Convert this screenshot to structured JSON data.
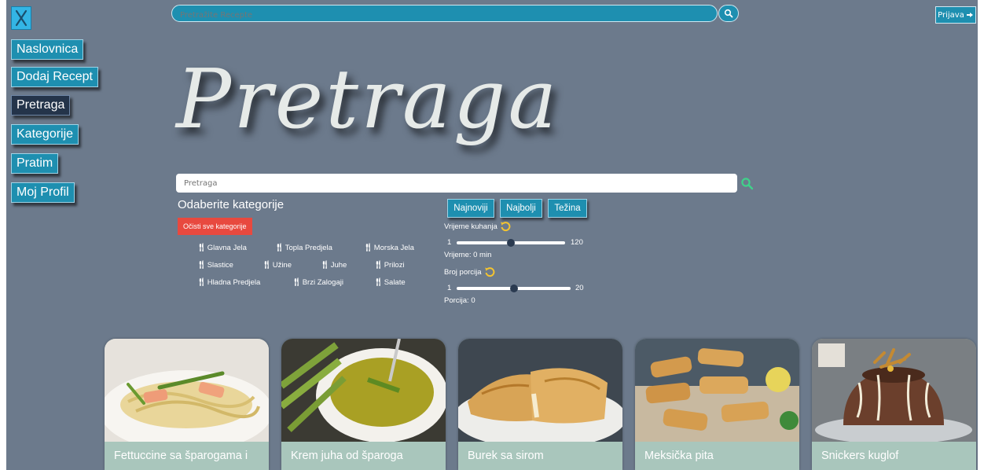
{
  "top_bar": {
    "search_placeholder": "Pretražite Recepte",
    "login_label": "Prijava"
  },
  "nav": {
    "items": [
      {
        "label": "Naslovnica"
      },
      {
        "label": "Dodaj Recept"
      },
      {
        "label": "Pretraga",
        "active": true
      },
      {
        "label": "Kategorije"
      },
      {
        "label": "Pratim"
      },
      {
        "label": "Moj Profil"
      }
    ]
  },
  "page": {
    "title": "Pretraga",
    "search_placeholder": "Pretraga"
  },
  "categories": {
    "heading": "Odaberite kategorije",
    "clear_label": "Očisti sve kategorije",
    "items": [
      "Glavna Jela",
      "Topla Predjela",
      "Morska Jela",
      "Slastice",
      "Užine",
      "Juhe",
      "Prilozi",
      "Hladna Predjela",
      "Brzi Zalogaji",
      "Salate"
    ]
  },
  "sort": {
    "buttons": [
      "Najnoviji",
      "Najbolji",
      "Težina"
    ]
  },
  "filters": {
    "time": {
      "label": "Vrijeme kuhanja",
      "min": "1",
      "max": "120",
      "value_fraction": 0.5,
      "readout": "Vrijeme: 0 min"
    },
    "portions": {
      "label": "Broj porcija",
      "min": "1",
      "max": "20",
      "value_fraction": 0.5,
      "readout": "Porcija: 0"
    }
  },
  "recipes": [
    {
      "title": "Fettuccine sa šparogama i",
      "image": "pasta-salmon-asparagus"
    },
    {
      "title": "Krem juha od šparoga",
      "image": "asparagus-soup"
    },
    {
      "title": "Burek sa sirom",
      "image": "cheese-burek"
    },
    {
      "title": "Meksička pita",
      "image": "mexican-pie-rolls"
    },
    {
      "title": "Snickers kuglof",
      "image": "snickers-bundt-cake"
    }
  ],
  "colors": {
    "background": "#6c7a8c",
    "accent": "#1e8fb0",
    "active_nav": "#24344a",
    "danger": "#e8493f",
    "card_footer": "#a9c6bc",
    "search_icon_green": "#3fd28a"
  }
}
